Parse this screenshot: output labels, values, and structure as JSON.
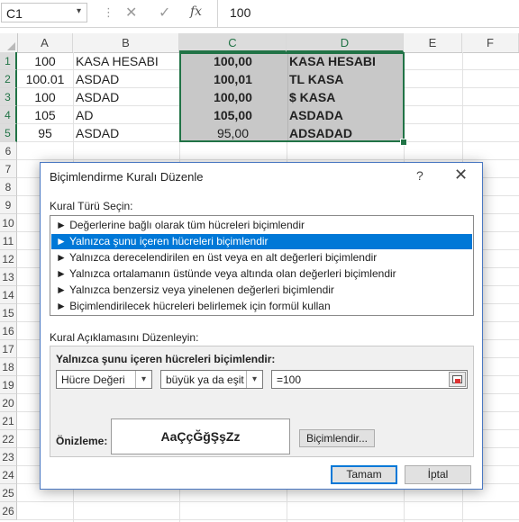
{
  "formula_bar": {
    "name_box": "C1",
    "name_box_dropdown_icon": "chevron-down-icon",
    "separator": "⋮",
    "cancel_icon": "✕",
    "enter_icon": "✓",
    "fx_label": "fx",
    "value": "100"
  },
  "columns": [
    "A",
    "B",
    "C",
    "D",
    "E",
    "F"
  ],
  "rows": [
    "1",
    "2",
    "3",
    "4",
    "5",
    "6",
    "7",
    "8",
    "9",
    "10",
    "11",
    "12",
    "13",
    "14",
    "15",
    "16",
    "17",
    "18",
    "19",
    "20",
    "21",
    "22",
    "23",
    "24",
    "25",
    "26"
  ],
  "cells": {
    "r1": {
      "a": "100",
      "b": "KASA HESABI",
      "c": "100,00",
      "d": "KASA HESABI"
    },
    "r2": {
      "a": "100.01",
      "b": "ASDAD",
      "c": "100,01",
      "d": "TL KASA"
    },
    "r3": {
      "a": "100",
      "b": "ASDAD",
      "c": "100,00",
      "d": "$ KASA"
    },
    "r4": {
      "a": "105",
      "b": "AD",
      "c": "105,00",
      "d": "ASDADA"
    },
    "r5": {
      "a": "95",
      "b": "ASDAD",
      "c": "95,00",
      "d": "ADSADAD"
    }
  },
  "dialog": {
    "title": "Biçimlendirme Kuralı Düzenle",
    "help": "?",
    "close": "✕",
    "rule_type_label": "Kural Türü Seçin:",
    "rule_types": [
      "► Değerlerine bağlı olarak tüm hücreleri biçimlendir",
      "► Yalnızca şunu içeren hücreleri biçimlendir",
      "► Yalnızca derecelendirilen en üst veya en alt değerleri biçimlendir",
      "► Yalnızca ortalamanın üstünde veya altında olan değerleri biçimlendir",
      "► Yalnızca benzersiz veya yinelenen değerleri biçimlendir",
      "► Biçimlendirilecek hücreleri belirlemek için formül kullan"
    ],
    "selected_rule_index": 1,
    "rule_desc_label": "Kural Açıklamasını Düzenleyin:",
    "edit_title": "Yalnızca şunu içeren hücreleri biçimlendir:",
    "condition_field": "Hücre Değeri",
    "condition_operator": "büyük ya da eşit",
    "condition_value": "=100",
    "dropdown_arrow": "▾",
    "preview_label": "Önizleme:",
    "preview_text": "AaÇçĞğŞşZz",
    "format_button": "Biçimlendir...",
    "ok_button": "Tamam",
    "cancel_button": "İptal"
  },
  "colors": {
    "selection_border": "#217346",
    "selection_fill": "#c8c8c8",
    "list_highlight": "#0078d7",
    "dialog_border": "#4a78c2"
  }
}
